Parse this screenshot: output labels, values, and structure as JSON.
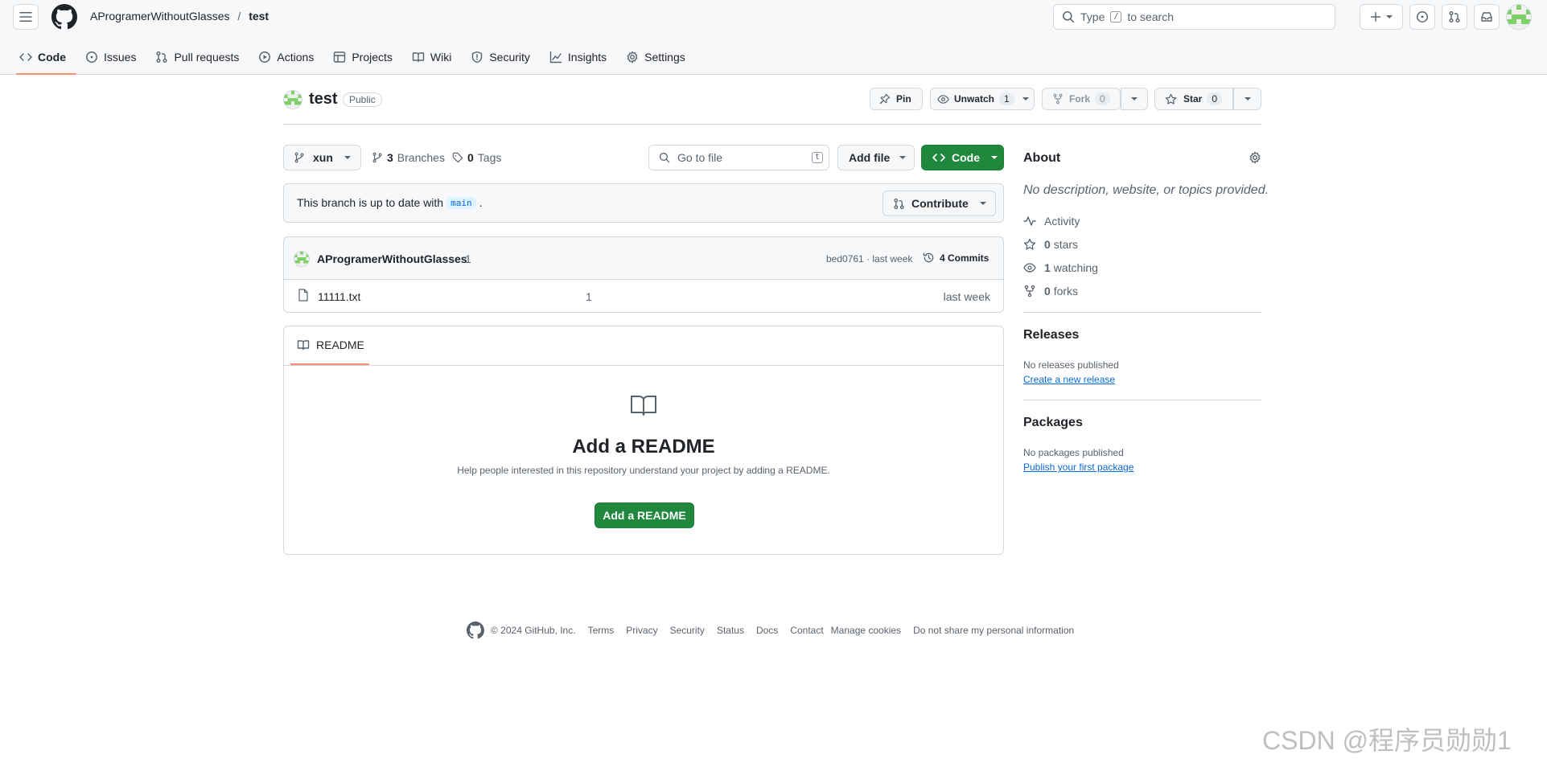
{
  "header": {
    "owner": "AProgramerWithoutGlasses",
    "separator": "/",
    "repo": "test",
    "search_before": "Type",
    "search_key": "/",
    "search_after": "to search"
  },
  "tabs": [
    {
      "label": "Code",
      "icon": "code-icon",
      "active": true
    },
    {
      "label": "Issues",
      "icon": "issue-icon"
    },
    {
      "label": "Pull requests",
      "icon": "pull-request-icon"
    },
    {
      "label": "Actions",
      "icon": "play-icon"
    },
    {
      "label": "Projects",
      "icon": "table-icon"
    },
    {
      "label": "Wiki",
      "icon": "book-icon"
    },
    {
      "label": "Security",
      "icon": "shield-icon"
    },
    {
      "label": "Insights",
      "icon": "graph-icon"
    },
    {
      "label": "Settings",
      "icon": "gear-icon"
    }
  ],
  "repo_head": {
    "name": "test",
    "visibility": "Public",
    "pin": "Pin",
    "unwatch": "Unwatch",
    "watch_count": "1",
    "fork": "Fork",
    "fork_count": "0",
    "star": "Star",
    "star_count": "0"
  },
  "toolbar": {
    "branch": "xun",
    "branches_count": "3",
    "branches_label": "Branches",
    "tags_count": "0",
    "tags_label": "Tags",
    "goto_placeholder": "Go to file",
    "goto_key": "t",
    "add_file": "Add file",
    "code": "Code"
  },
  "branch_banner": {
    "text_before": "This branch is up to date with",
    "branch": "main",
    "text_after": ".",
    "contribute": "Contribute"
  },
  "commit": {
    "author": "AProgramerWithoutGlasses",
    "message": "1",
    "hash_time": "bed0761 · last week",
    "commits": "4 Commits"
  },
  "files": [
    {
      "name": "11111.txt",
      "message": "1",
      "time": "last week"
    }
  ],
  "readme": {
    "tab": "README",
    "title": "Add a README",
    "desc": "Help people interested in this repository understand your project by adding a README.",
    "button": "Add a README"
  },
  "about": {
    "title": "About",
    "desc": "No description, website, or topics provided.",
    "activity": "Activity",
    "stars_n": "0",
    "stars": "stars",
    "watching_n": "1",
    "watching": "watching",
    "forks_n": "0",
    "forks": "forks"
  },
  "releases": {
    "title": "Releases",
    "text": "No releases published",
    "link": "Create a new release"
  },
  "packages": {
    "title": "Packages",
    "text": "No packages published",
    "link": "Publish your first package"
  },
  "footer": {
    "copyright": "© 2024 GitHub, Inc.",
    "links": [
      "Terms",
      "Privacy",
      "Security",
      "Status",
      "Docs",
      "Contact",
      "Manage cookies",
      "Do not share my personal information"
    ]
  },
  "watermark": "CSDN @程序员勋勋1",
  "colors": {
    "primary_green": "#1f883d",
    "link_blue": "#0969da",
    "tab_underline": "#fd8c73"
  }
}
